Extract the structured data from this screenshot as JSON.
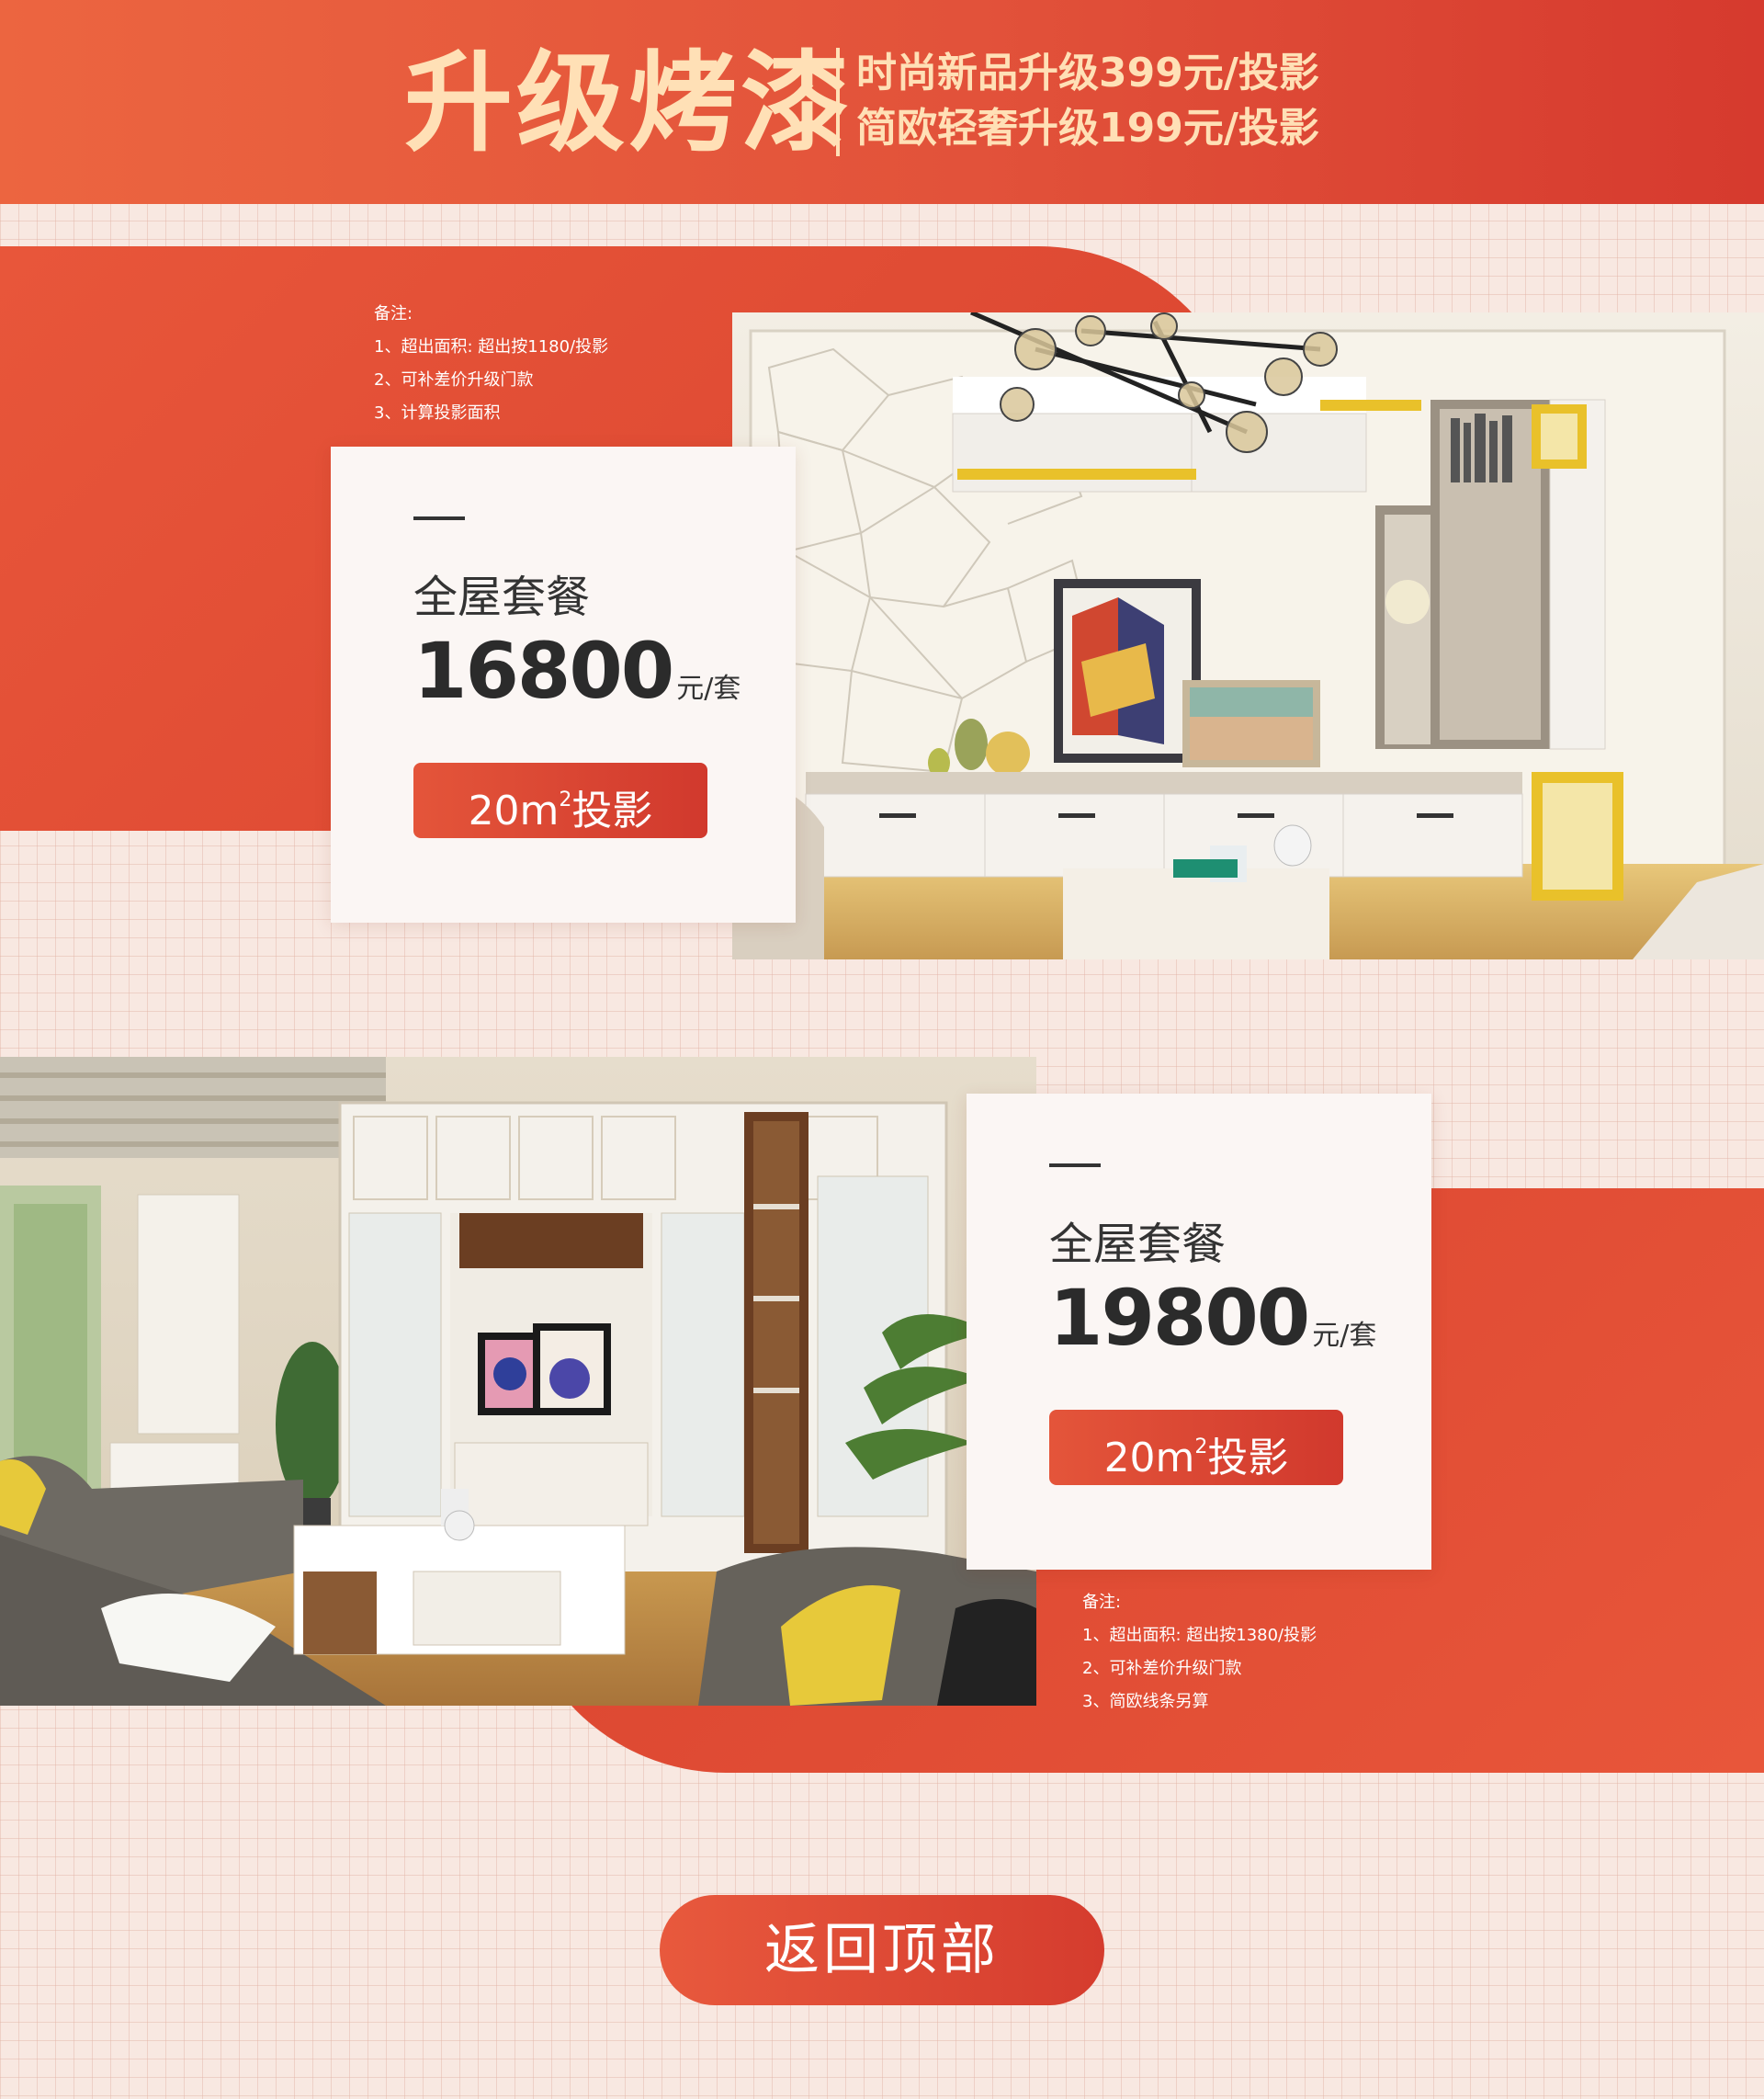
{
  "banner": {
    "title": "升级烤漆",
    "line1": "时尚新品升级399元/投影",
    "line2": "简欧轻奢升级199元/投影"
  },
  "package1": {
    "notes": [
      "备注:",
      "1、超出面积: 超出按1180/投影",
      "2、可补差价升级门款",
      "3、计算投影面积"
    ],
    "title": "全屋套餐",
    "price": "16800",
    "unit": "元/套",
    "area_main": "20m",
    "area_sup": "2",
    "area_suffix": "投影"
  },
  "package2": {
    "notes": [
      "备注:",
      "1、超出面积: 超出按1380/投影",
      "2、可补差价升级门款",
      "3、简欧线条另算"
    ],
    "title": "全屋套餐",
    "price": "19800",
    "unit": "元/套",
    "area_main": "20m",
    "area_sup": "2",
    "area_suffix": "投影"
  },
  "back_to_top": "返回顶部",
  "colors": {
    "accent": "#e0503a",
    "banner_text": "#ffe0b6",
    "background": "#f8e8e1"
  }
}
